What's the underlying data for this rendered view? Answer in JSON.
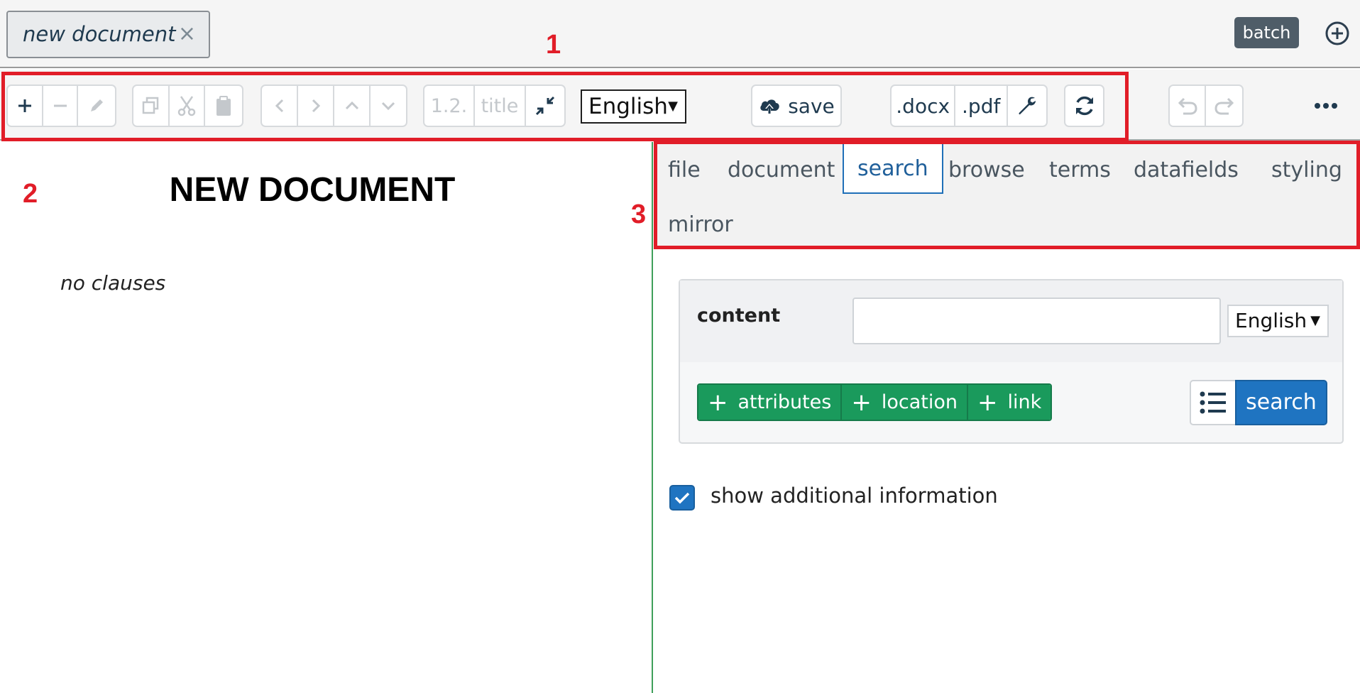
{
  "document_tab": {
    "label": "new document",
    "close_symbol": "×"
  },
  "batch_label": "batch",
  "toolbar": {
    "numbering_label": "1.2.",
    "title_label": "title",
    "language": "English",
    "save_label": "save",
    "docx_label": ".docx",
    "pdf_label": ".pdf"
  },
  "document": {
    "title": "NEW DOCUMENT",
    "empty_text": "no clauses"
  },
  "tabs": [
    {
      "label": "file"
    },
    {
      "label": "document"
    },
    {
      "label": "search",
      "active": true
    },
    {
      "label": "browse"
    },
    {
      "label": "terms"
    },
    {
      "label": "datafields"
    },
    {
      "label": "styling"
    },
    {
      "label": "mirror"
    }
  ],
  "search": {
    "content_label": "content",
    "content_value": "",
    "language": "English",
    "add_attributes_label": "attributes",
    "add_location_label": "location",
    "add_link_label": "link",
    "search_label": "search"
  },
  "show_additional_info": {
    "label": "show additional information",
    "checked": true
  },
  "annotations": [
    "1",
    "2",
    "3"
  ],
  "colors": {
    "accent_blue": "#1f74c1",
    "green": "#1a9a5c",
    "annotation_red": "#e11d28"
  },
  "icons": [
    "plus-icon",
    "minus-icon",
    "pencil-icon",
    "copy-icon",
    "cut-icon",
    "paste-icon",
    "chevron-left-icon",
    "chevron-right-icon",
    "chevron-up-icon",
    "chevron-down-icon",
    "collapse-icon",
    "cloud-upload-icon",
    "wrench-icon",
    "refresh-icon",
    "undo-icon",
    "redo-icon",
    "more-icon",
    "list-icon",
    "check-icon",
    "add-circle-icon"
  ]
}
